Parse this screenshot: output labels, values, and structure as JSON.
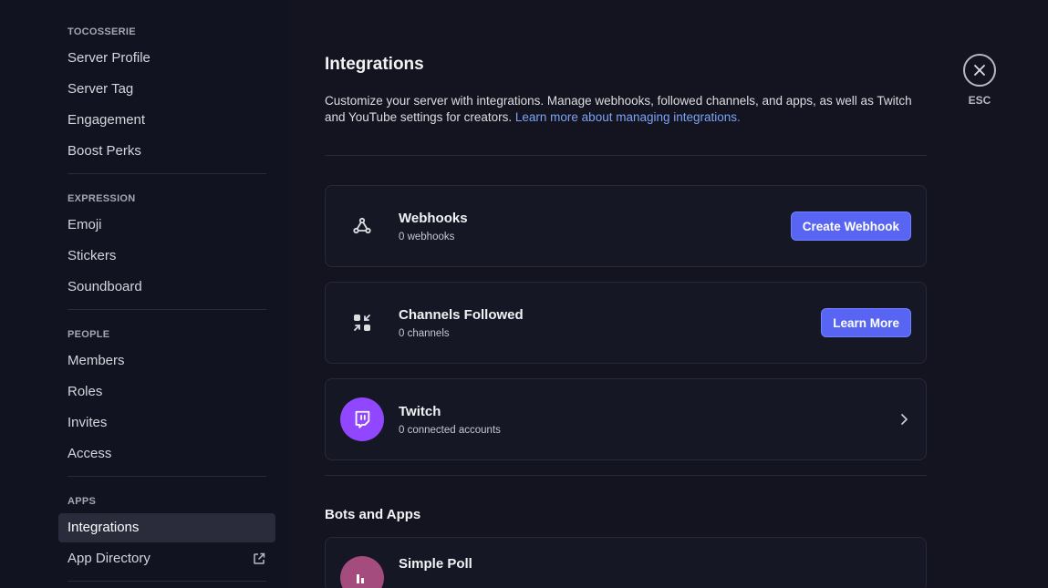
{
  "sidebar": {
    "sections": [
      {
        "header": "TOCOSSERIE",
        "items": [
          "Server Profile",
          "Server Tag",
          "Engagement",
          "Boost Perks"
        ]
      },
      {
        "header": "EXPRESSION",
        "items": [
          "Emoji",
          "Stickers",
          "Soundboard"
        ]
      },
      {
        "header": "PEOPLE",
        "items": [
          "Members",
          "Roles",
          "Invites",
          "Access"
        ]
      },
      {
        "header": "APPS",
        "items": [
          "Integrations",
          "App Directory"
        ]
      }
    ],
    "active_item": "Integrations"
  },
  "main": {
    "title": "Integrations",
    "description": "Customize your server with integrations. Manage webhooks, followed channels, and apps, as well as Twitch and YouTube settings for creators. ",
    "learn_more_link": "Learn more about managing integrations.",
    "cards": [
      {
        "title": "Webhooks",
        "sub": "0 webhooks",
        "button": "Create Webhook",
        "icon": "webhook-icon"
      },
      {
        "title": "Channels Followed",
        "sub": "0 channels",
        "button": "Learn More",
        "icon": "channels-followed-icon"
      },
      {
        "title": "Twitch",
        "sub": "0 connected accounts",
        "icon": "twitch-icon"
      }
    ],
    "bots_title": "Bots and Apps",
    "bots": [
      {
        "name": "Simple Poll"
      }
    ]
  },
  "close": {
    "label": "ESC"
  },
  "colors": {
    "accent": "#5865f2",
    "twitch": "#9146ff",
    "link": "#7ba3f5"
  }
}
